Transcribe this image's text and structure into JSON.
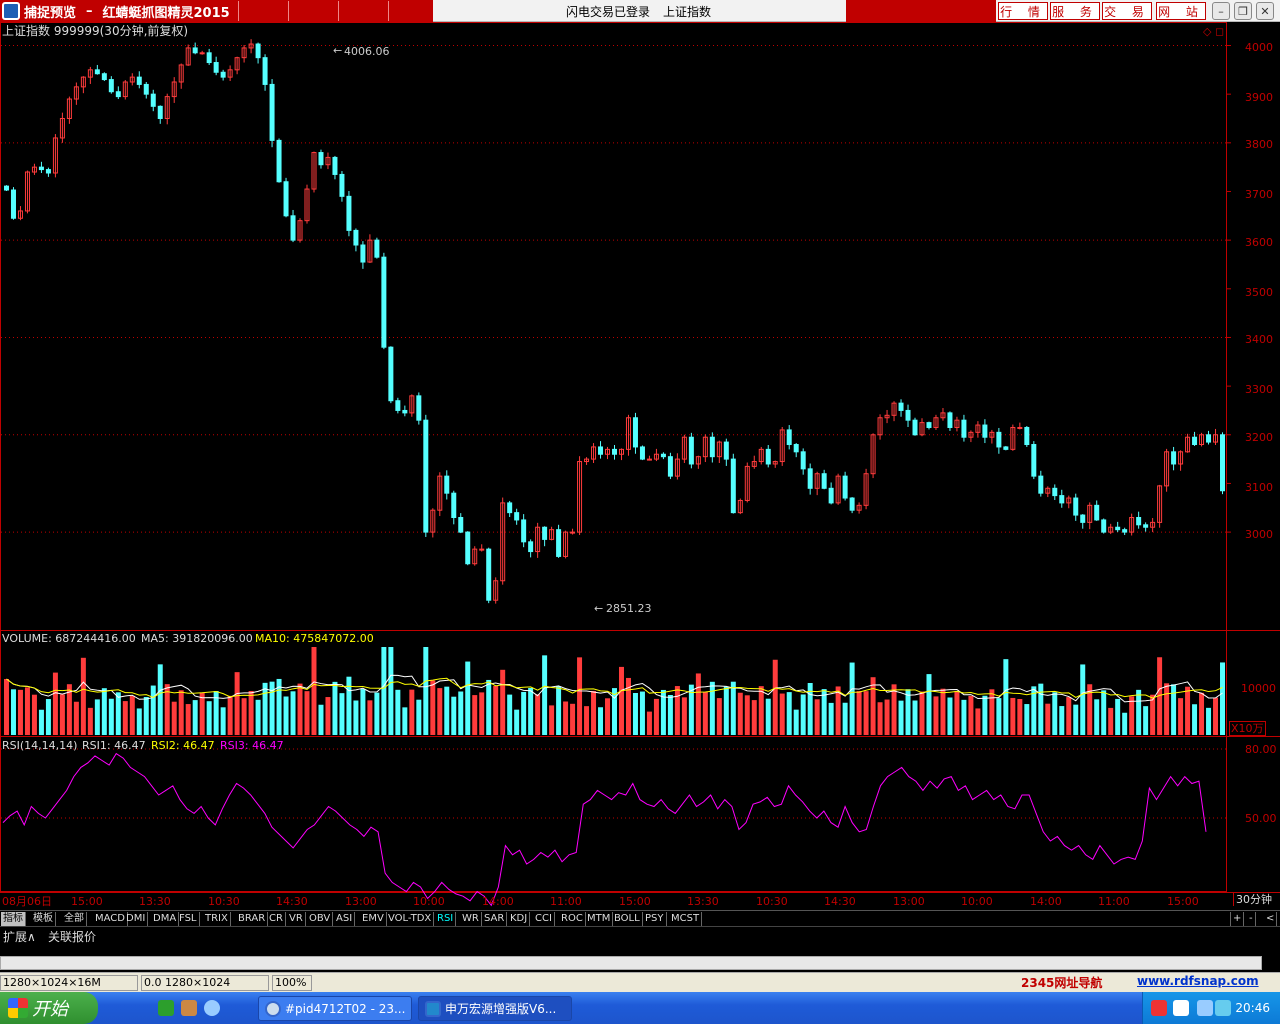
{
  "window": {
    "title": "捕捉预览",
    "separator": "–",
    "subtitle": "红蜻蜓抓图精灵2015",
    "login_status": "闪电交易已登录",
    "security_name": "上证指数"
  },
  "nav_buttons": [
    "行 情",
    "服 务",
    "交 易",
    "网 站"
  ],
  "main_chart": {
    "label": "上证指数 999999(30分钟,前复权)",
    "y_ticks": [
      "4000",
      "3900",
      "3800",
      "3700",
      "3600",
      "3500",
      "3400",
      "3300",
      "3200",
      "3100",
      "3000"
    ],
    "high_label": "4006.06",
    "low_label": "2851.23"
  },
  "volume": {
    "label": "VOLUME: 687244416.00",
    "ma5_label": "MA5: 391820096.00",
    "ma10_label": "MA10: 475847072.00",
    "y_tick": "10000",
    "unit": "X10万"
  },
  "rsi": {
    "label": "RSI(14,14,14)",
    "rsi1_label": "RSI1: 46.47",
    "rsi2_label": "RSI2: 46.47",
    "rsi3_label": "RSI3: 46.47",
    "y_ticks": [
      "80.00",
      "50.00"
    ]
  },
  "x_axis": {
    "labels": [
      "08月06日",
      "15:00",
      "13:30",
      "10:30",
      "14:30",
      "13:00",
      "10:00",
      "14:00",
      "11:00",
      "15:00",
      "13:30",
      "10:30",
      "14:30",
      "13:00",
      "10:00",
      "14:00",
      "11:00",
      "15:00"
    ],
    "period": "30分钟"
  },
  "indicator_tabs": [
    "指标",
    "模板",
    "全部",
    "MACD",
    "DMI",
    "DMA",
    "FSL",
    "TRIX",
    "BRAR",
    "CR",
    "VR",
    "OBV",
    "ASI",
    "EMV",
    "VOL-TDX",
    "RSI",
    "WR",
    "SAR",
    "KDJ",
    "CCI",
    "ROC",
    "MTM",
    "BOLL",
    "PSY",
    "MCST"
  ],
  "active_tab": "RSI",
  "tab_controls": [
    "+",
    "-",
    "<"
  ],
  "extension_tabs": [
    "扩展∧",
    "关联报价"
  ],
  "status_bar": {
    "resolution": "1280×1024×16M",
    "coords": "0.0 1280×1024",
    "zoom": "100%",
    "link1": "2345网址导航",
    "link2": "www.rdfsnap.com"
  },
  "taskbar": {
    "start_label": "开始",
    "tasks": [
      "#pid4712T02 - 23...",
      "申万宏源增强版V6..."
    ],
    "clock": "20:46"
  },
  "colors": {
    "up": "#ff3c3c",
    "down": "#55ffff",
    "axis": "#c00000",
    "ma5": "#ffffff",
    "ma10": "#ffff00",
    "rsi": "#ff00ff"
  },
  "chart_data": {
    "type": "candlestick",
    "period": "30min",
    "ylim": [
      2851.23,
      4006.06
    ],
    "points": [
      3703,
      3645,
      3660,
      3740,
      3750,
      3745,
      3738,
      3810,
      3850,
      3890,
      3915,
      3935,
      3950,
      3942,
      3930,
      3905,
      3895,
      3925,
      3935,
      3920,
      3900,
      3875,
      3850,
      3895,
      3925,
      3960,
      3995,
      3985,
      3985,
      3965,
      3945,
      3935,
      3950,
      3975,
      3995,
      4003,
      3975,
      3920,
      3805,
      3720,
      3650,
      3600,
      3640,
      3705,
      3780,
      3755,
      3770,
      3735,
      3690,
      3620,
      3590,
      3555,
      3600,
      3565,
      3380,
      3270,
      3250,
      3245,
      3280,
      3230,
      3000,
      3045,
      3115,
      3080,
      3030,
      3000,
      2935,
      2965,
      2965,
      2860,
      2900,
      3060,
      3040,
      3025,
      2980,
      2960,
      3010,
      2985,
      3005,
      2950,
      3000,
      3000,
      3145,
      3150,
      3175,
      3160,
      3170,
      3160,
      3170,
      3235,
      3175,
      3150,
      3150,
      3160,
      3155,
      3115,
      3150,
      3195,
      3140,
      3155,
      3195,
      3155,
      3185,
      3150,
      3040,
      3065,
      3135,
      3145,
      3170,
      3140,
      3145,
      3210,
      3180,
      3165,
      3130,
      3090,
      3120,
      3090,
      3060,
      3115,
      3070,
      3045,
      3055,
      3120,
      3200,
      3235,
      3240,
      3265,
      3250,
      3230,
      3200,
      3225,
      3215,
      3235,
      3245,
      3215,
      3230,
      3195,
      3205,
      3220,
      3195,
      3205,
      3175,
      3170,
      3215,
      3215,
      3180,
      3115,
      3080,
      3090,
      3075,
      3060,
      3070,
      3035,
      3020,
      3055,
      3025,
      3000,
      3010,
      3005,
      3000,
      3030,
      3015,
      3010,
      3020,
      3095,
      3165,
      3140,
      3165,
      3195,
      3180,
      3200,
      3185,
      3200,
      3085
    ],
    "rsi": [
      48,
      51,
      53,
      47,
      55,
      52,
      50,
      54,
      58,
      62,
      68,
      72,
      74,
      77,
      75,
      73,
      78,
      76,
      72,
      70,
      68,
      64,
      60,
      62,
      64,
      58,
      54,
      52,
      55,
      50,
      47,
      54,
      60,
      65,
      63,
      60,
      56,
      52,
      46,
      43,
      40,
      37,
      41,
      45,
      47,
      51,
      55,
      53,
      50,
      47,
      45,
      42,
      46,
      44,
      26,
      22,
      20,
      18,
      22,
      20,
      15,
      18,
      22,
      19,
      17,
      16,
      14,
      18,
      16,
      12,
      20,
      38,
      34,
      36,
      30,
      32,
      35,
      33,
      36,
      31,
      34,
      35,
      56,
      58,
      62,
      60,
      58,
      61,
      60,
      65,
      58,
      56,
      55,
      58,
      54,
      52,
      56,
      60,
      55,
      57,
      60,
      54,
      58,
      55,
      45,
      48,
      56,
      57,
      59,
      55,
      56,
      64,
      60,
      57,
      53,
      50,
      53,
      48,
      46,
      55,
      48,
      44,
      45,
      55,
      64,
      68,
      70,
      72,
      68,
      66,
      62,
      66,
      63,
      67,
      68,
      62,
      64,
      58,
      60,
      62,
      58,
      60,
      55,
      54,
      60,
      60,
      52,
      44,
      40,
      42,
      38,
      36,
      38,
      34,
      32,
      38,
      34,
      30,
      32,
      33,
      32,
      40,
      63,
      58,
      63,
      68,
      64,
      68,
      65,
      66,
      44
    ],
    "ma5_volume": 391820096.0,
    "ma10_volume": 475847072.0
  }
}
